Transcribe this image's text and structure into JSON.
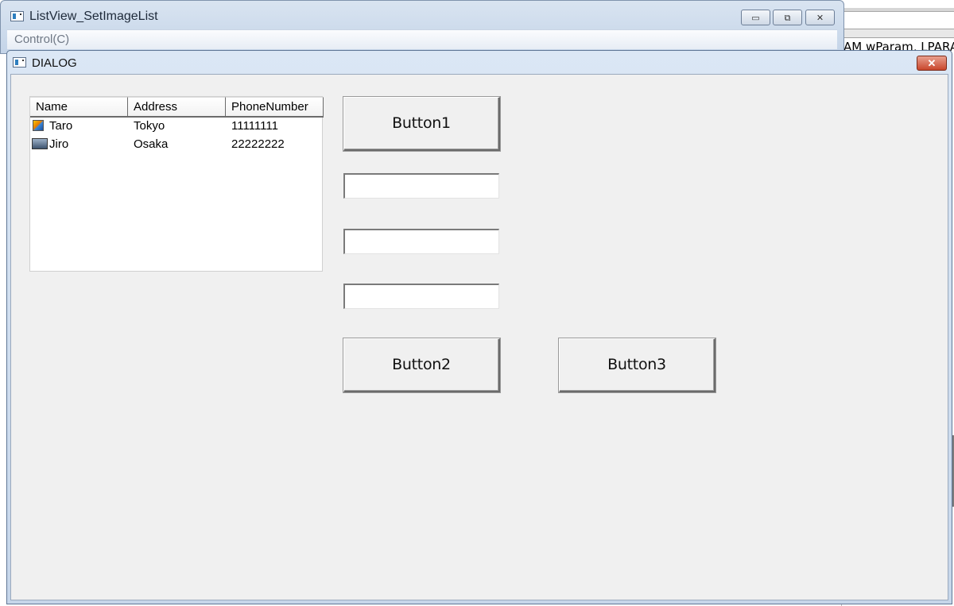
{
  "background_editor": {
    "code_fragment": "AM wParam, LPARA"
  },
  "main_window": {
    "title": "ListView_SetImageList",
    "menu": [
      "Control(C)"
    ],
    "caption_buttons": {
      "minimize": "▭",
      "restore": "⧉",
      "close": "✕"
    },
    "icon": "app-window-icon"
  },
  "dialog": {
    "title": "DIALOG",
    "close_glyph": "✕",
    "icon": "app-window-icon",
    "listview": {
      "columns": [
        "Name",
        "Address",
        "PhoneNumber"
      ],
      "rows": [
        {
          "icon": "pencil-note-icon",
          "name": "Taro",
          "address": "Tokyo",
          "phone": "11111111"
        },
        {
          "icon": "monitor-image-icon",
          "name": "Jiro",
          "address": "Osaka",
          "phone": "22222222"
        }
      ]
    },
    "buttons": {
      "button1": "Button1",
      "button2": "Button2",
      "button3": "Button3"
    },
    "edits": {
      "edit1": "",
      "edit2": "",
      "edit3": ""
    }
  },
  "colors": {
    "dialog_face": "#f0f0f0",
    "title_gradient_top": "#dbe7f5",
    "close_button": "#c8462c"
  }
}
